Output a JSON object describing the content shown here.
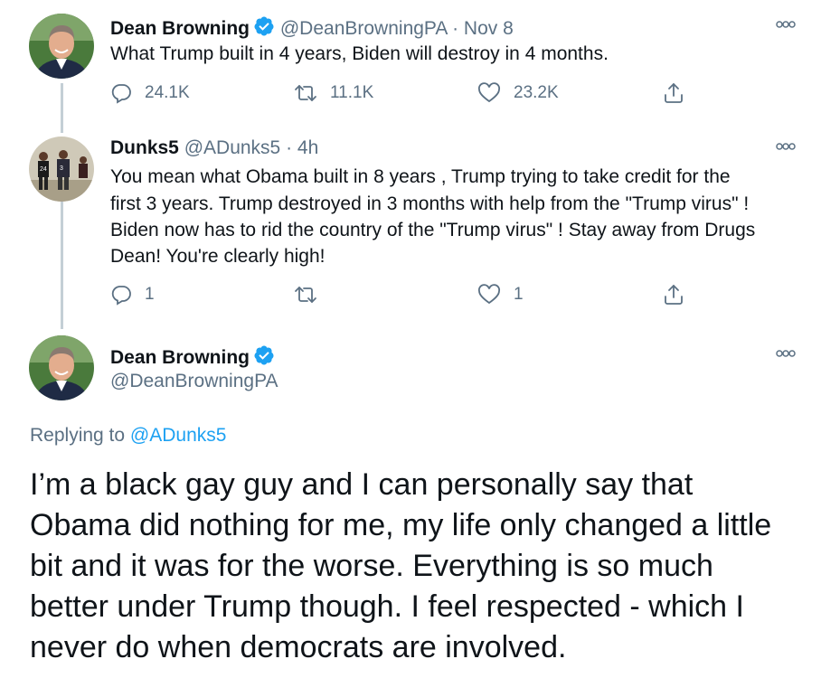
{
  "colors": {
    "accent": "#1da1f2",
    "secondary_text": "#5b7083",
    "thread_line": "#c4cfd6"
  },
  "tweet1": {
    "name": "Dean Browning",
    "handle": "@DeanBrowningPA",
    "separator": "·",
    "time": "Nov 8",
    "text": "What Trump built in 4 years, Biden will destroy in 4 months.",
    "replies": "24.1K",
    "retweets": "11.1K",
    "likes": "23.2K"
  },
  "tweet2": {
    "name": "Dunks5",
    "handle": "@ADunks5",
    "separator": "·",
    "time": "4h",
    "lines": [
      "You mean what Obama built in 8 years , Trump trying to take credit for the",
      "first 3 years. Trump destroyed in 3 months with help from the \"Trump virus\" !",
      "Biden now has to rid the country of the \"Trump virus\" ! Stay away from Drugs",
      "Dean! You're clearly high!"
    ],
    "replies": "1",
    "retweets": "",
    "likes": "1"
  },
  "tweet3": {
    "name": "Dean Browning",
    "handle": "@DeanBrowningPA",
    "replying_prefix": "Replying to",
    "replying_to": "@ADunks5",
    "lines": [
      "I’m a black gay guy and I can personally say that",
      "Obama did nothing for me, my life only changed a little",
      "bit and it was for the worse. Everything is so much",
      "better under Trump though. I feel respected - which I",
      "never do when democrats are involved."
    ]
  },
  "icons": [
    "reply-icon",
    "retweet-icon",
    "like-icon",
    "share-icon",
    "more-icon",
    "verified-badge-icon"
  ]
}
